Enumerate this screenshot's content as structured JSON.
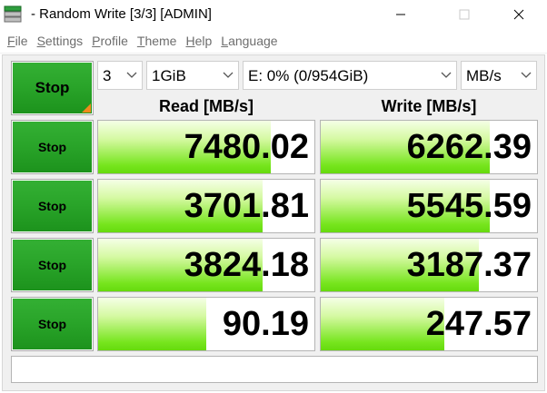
{
  "window": {
    "title": "- Random Write [3/3] [ADMIN]",
    "minimize_icon": "minimize-icon",
    "maximize_icon": "maximize-icon",
    "close_icon": "close-icon"
  },
  "menu": {
    "items": [
      {
        "hotkey": "F",
        "rest": "ile"
      },
      {
        "hotkey": "S",
        "rest": "ettings"
      },
      {
        "hotkey": "P",
        "rest": "rofile"
      },
      {
        "hotkey": "T",
        "rest": "heme"
      },
      {
        "hotkey": "H",
        "rest": "elp"
      },
      {
        "hotkey": "L",
        "rest": "anguage"
      }
    ]
  },
  "controls": {
    "all_button_label": "Stop",
    "count": "3",
    "size": "1GiB",
    "drive": "E: 0% (0/954GiB)",
    "unit": "MB/s"
  },
  "headers": {
    "read": "Read [MB/s]",
    "write": "Write [MB/s]"
  },
  "rows": [
    {
      "button_label": "Stop",
      "read": "7480.02",
      "write": "6262.39",
      "read_fill": 0.8,
      "write_fill": 0.78
    },
    {
      "button_label": "Stop",
      "read": "3701.81",
      "write": "5545.59",
      "read_fill": 0.76,
      "write_fill": 0.78
    },
    {
      "button_label": "Stop",
      "read": "3824.18",
      "write": "3187.37",
      "read_fill": 0.76,
      "write_fill": 0.73
    },
    {
      "button_label": "Stop",
      "read": "90.19",
      "write": "247.57",
      "read_fill": 0.5,
      "write_fill": 0.57
    }
  ],
  "comment": "",
  "colors": {
    "button_green": "#2aa52a",
    "bar_green": "#76e51d",
    "corner_orange": "#f08a1c"
  }
}
